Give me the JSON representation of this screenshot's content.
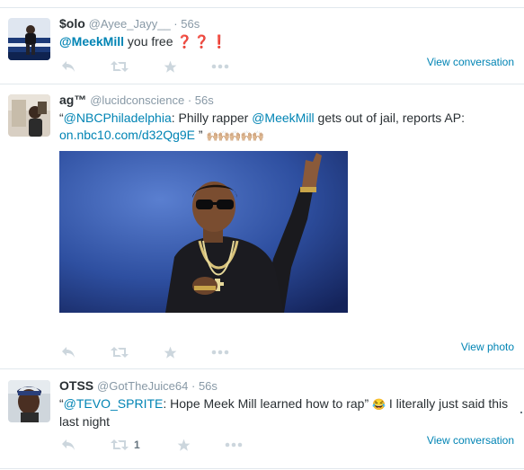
{
  "tweets": [
    {
      "name": "$olo",
      "handle": "@Ayee_Jayy__",
      "time": "56s",
      "text": {
        "mention": "@MeekMill",
        "rest": " you free",
        "marks": "❓❓❗"
      },
      "view_link": "View conversation",
      "retweet_count": ""
    },
    {
      "name": "ag™",
      "handle": "@lucidconscience",
      "time": "56s",
      "text": {
        "open_quote": "“",
        "mention1": "@NBCPhiladelphia",
        "part1": ": Philly rapper ",
        "mention2": "@MeekMill",
        "part2": " gets out of jail, reports AP:",
        "url": "on.nbc10.com/d32Qg9E",
        "close_quote": " ”",
        "emoji": "🙌🏼🙌🏼🙌🏼🙌🏼🙌🏼"
      },
      "view_link": "View photo",
      "retweet_count": ""
    },
    {
      "name": "OTSS",
      "handle": "@GotTheJuice64",
      "time": "56s",
      "text": {
        "open_quote": "“",
        "mention": "@TEVO_SPRITE",
        "part1": ": Hope Meek Mill learned how to rap” ",
        "emoji": "😂",
        "part2": " I literally just said this last night"
      },
      "view_link": "View conversation",
      "retweet_count": "1"
    }
  ],
  "separator": " · ",
  "icons": {
    "reply": "reply-icon",
    "retweet": "retweet-icon",
    "favorite": "star-icon",
    "more": "more-dots-icon"
  },
  "colors": {
    "link": "#0084b4",
    "meta": "#8899a6",
    "icon": "#ccd6dd",
    "text": "#292f33"
  }
}
